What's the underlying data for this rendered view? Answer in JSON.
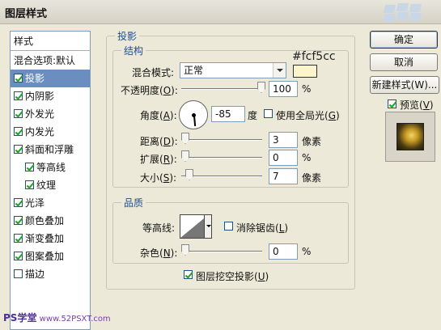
{
  "window": {
    "title": "图层样式"
  },
  "styles_list": {
    "header": "样式",
    "blend_options": "混合选项:默认",
    "items": [
      {
        "label": "投影",
        "checked": true,
        "selected": true
      },
      {
        "label": "内阴影",
        "checked": true
      },
      {
        "label": "外发光",
        "checked": true
      },
      {
        "label": "内发光",
        "checked": true
      },
      {
        "label": "斜面和浮雕",
        "checked": true
      },
      {
        "label": "等高线",
        "checked": true,
        "indent": true
      },
      {
        "label": "纹理",
        "checked": true,
        "indent": true
      },
      {
        "label": "光泽",
        "checked": true
      },
      {
        "label": "颜色叠加",
        "checked": true
      },
      {
        "label": "渐变叠加",
        "checked": true
      },
      {
        "label": "图案叠加",
        "checked": true
      },
      {
        "label": "描边",
        "checked": false
      }
    ]
  },
  "panel": {
    "title": "投影",
    "structure": {
      "title": "结构",
      "blend_mode_label": "混合模式:",
      "blend_mode_value": "正常",
      "color_hex": "#fcf5cc",
      "opacity_label_pre": "不透明度(",
      "opacity_key": "O",
      "opacity_label_post": "):",
      "opacity_value": "100",
      "opacity_unit": "%",
      "angle_label_pre": "角度(",
      "angle_key": "A",
      "angle_label_post": "):",
      "angle_value": "-85",
      "angle_unit": "度",
      "global_light_pre": "使用全局光(",
      "global_light_key": "G",
      "global_light_post": ")",
      "distance_label_pre": "距离(",
      "distance_key": "D",
      "distance_label_post": "):",
      "distance_value": "3",
      "distance_unit": "像素",
      "spread_label_pre": "扩展(",
      "spread_key": "R",
      "spread_label_post": "):",
      "spread_value": "0",
      "spread_unit": "%",
      "size_label_pre": "大小(",
      "size_key": "S",
      "size_label_post": "):",
      "size_value": "7",
      "size_unit": "像素"
    },
    "quality": {
      "title": "品质",
      "contour_label": "等高线:",
      "antialias_pre": "消除锯齿(",
      "antialias_key": "L",
      "antialias_post": ")",
      "noise_label_pre": "杂色(",
      "noise_key": "N",
      "noise_label_post": "):",
      "noise_value": "0",
      "noise_unit": "%"
    },
    "knockout_pre": "图层挖空投影(",
    "knockout_key": "U",
    "knockout_post": ")"
  },
  "buttons": {
    "ok": "确定",
    "cancel": "取消",
    "new_style": "新建样式(W)...",
    "preview_pre": "预览(",
    "preview_key": "V",
    "preview_post": ")"
  },
  "watermark": {
    "site": "PS学堂",
    "url": "www.52PSXT.com"
  },
  "colors": {
    "accent_title": "#1e4e9a",
    "selected_row": "#6b8ec0",
    "shadow_color": "#fcf5cc"
  }
}
